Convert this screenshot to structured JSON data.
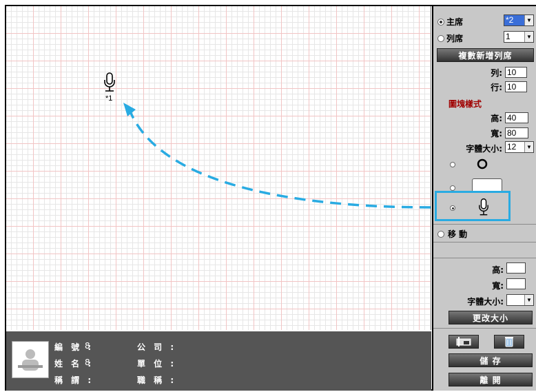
{
  "canvas": {
    "items": [
      {
        "label": "*1",
        "icon": "microphone-icon"
      }
    ]
  },
  "info": {
    "number_label": "編 號 :",
    "number_value": "8",
    "name_label": "姓 名 :",
    "name_value": "8",
    "title_label": "稱 謂 :",
    "title_value": "",
    "company_label": "公 司 :",
    "company_value": "",
    "unit_label": "單 位 :",
    "unit_value": "",
    "job_label": "職 稱 :",
    "job_value": ""
  },
  "panel": {
    "chair_label": "主席",
    "chair_select": "*2",
    "seat_label": "列席",
    "seat_select": "1",
    "batch_add_button": "複數新增列席",
    "cols_label": "列:",
    "cols_value": "10",
    "rows_label": "行:",
    "rows_value": "10",
    "style_heading": "圖塊樣式",
    "height_label": "高:",
    "height_value": "40",
    "width_label": "寬:",
    "width_value": "80",
    "font_size_label": "字體大小:",
    "font_size_value": "12",
    "move_label": "移 動",
    "resize_height_label": "高:",
    "resize_width_label": "寬:",
    "resize_font_label": "字體大小:",
    "resize_button": "更改大小",
    "save_button": "儲 存",
    "exit_button": "離 開"
  },
  "colors": {
    "highlight": "#29abe2",
    "style_heading": "#a00000"
  }
}
